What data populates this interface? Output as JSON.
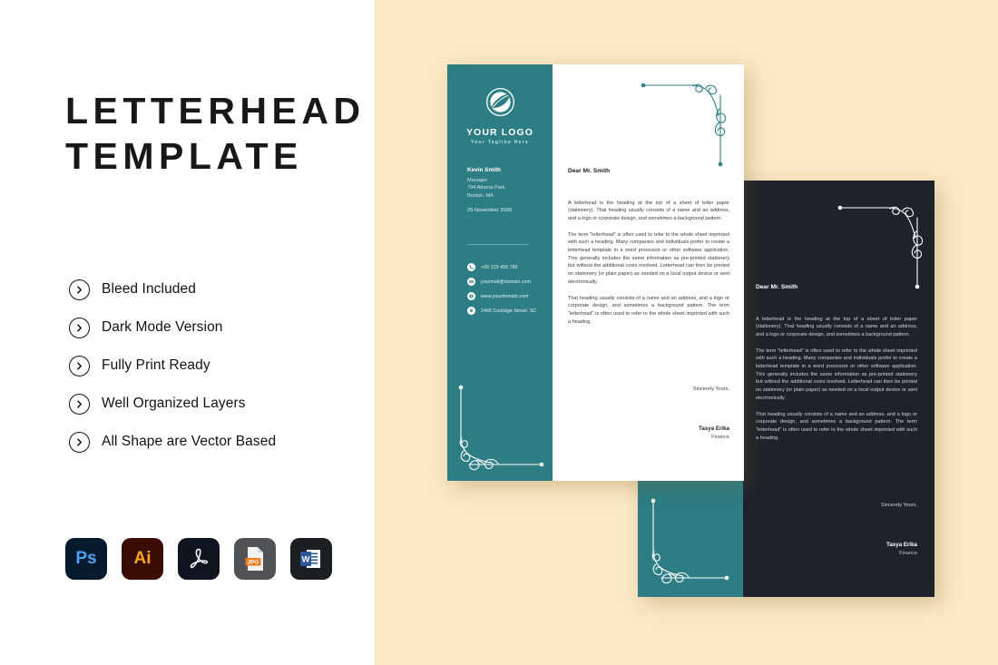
{
  "colors": {
    "left_bg": "#ffffff",
    "right_bg": "#fceac5",
    "teal": "#2d7d85",
    "dark": "#1d222c",
    "title_text": "#16181a",
    "photoshop_bg": "#071a2e",
    "photoshop_fg": "#4ea0f5",
    "illustrator_bg": "#3a0d04",
    "illustrator_fg": "#f5a623",
    "pdf_bg": "#0e1420",
    "jpg_bg": "#4f5257",
    "jpg_accent": "#f07c20",
    "word_bg": "#1b1f24",
    "word_accent": "#2b579a"
  },
  "headline": {
    "line1": "LETTERHEAD",
    "line2": "TEMPLATE"
  },
  "features": [
    {
      "label": "Bleed Included",
      "icon": "chevron-right-circle-icon"
    },
    {
      "label": "Dark Mode Version",
      "icon": "chevron-right-circle-icon"
    },
    {
      "label": "Fully Print Ready",
      "icon": "chevron-right-circle-icon"
    },
    {
      "label": "Well Organized Layers",
      "icon": "chevron-right-circle-icon"
    },
    {
      "label": "All Shape are Vector Based",
      "icon": "chevron-right-circle-icon"
    }
  ],
  "file_formats": [
    {
      "name": "photoshop-icon",
      "label": "Ps"
    },
    {
      "name": "illustrator-icon",
      "label": "Ai"
    },
    {
      "name": "pdf-icon",
      "label": ""
    },
    {
      "name": "jpg-icon",
      "label": "JPG"
    },
    {
      "name": "word-icon",
      "label": "W"
    }
  ],
  "letterhead": {
    "logo": {
      "name": "YOUR LOGO",
      "tagline": "Your Tagline Here"
    },
    "sender": {
      "name": "Kevin Smith",
      "role": "Manager",
      "address_line1": "794 Athena Park,",
      "address_line2": "Boston, MA",
      "date": "25 November 2020"
    },
    "contacts": [
      {
        "icon": "phone-icon",
        "text": "+00 123 456 789"
      },
      {
        "icon": "mail-icon",
        "text": "yourmail@domain.com"
      },
      {
        "icon": "globe-icon",
        "text": "www.yourdomain.com"
      },
      {
        "icon": "location-icon",
        "text": "2466 Coolidge Street, SC"
      }
    ],
    "greeting": "Dear Mr. Smith",
    "paragraphs": [
      "A letterhead is the heading at the top of a sheet of letter paper (stationery). That heading usually consists of a name and an address, and a logo or corporate design, and sometimes a background pattern.",
      "The term \"letterhead\" is often used to refer to the whole sheet imprinted with such a heading. Many companies and individuals prefer to create a letterhead template in a word processor or other software application. This generally includes the same information as pre-printed stationery but without the additional costs involved. Letterhead can then be printed on stationery (or plain paper) as needed on a local output device or sent electronically.",
      "That heading usually consists of a name and an address, and a logo or corporate design, and sometimes a background pattern. The term \"letterhead\" is often used to refer to the whole sheet imprinted with such a heading."
    ],
    "closing": "Sincerely Yours,",
    "signature": {
      "name": "Tasya Erika",
      "role": "Finance"
    }
  },
  "letterhead_dark": {
    "greeting": "Dear Mr. Smith",
    "paragraphs": [
      "A letterhead is the heading at the top of a sheet of letter paper (stationery). That heading usually consists of a name and an address, and a logo or corporate design, and sometimes a background pattern.",
      "The term \"letterhead\" is often used to refer to the whole sheet imprinted with such a heading. Many companies and individuals prefer to create a letterhead template in a word processor or other software application. This generally includes the same information as pre-printed stationery but without the additional costs involved. Letterhead can then be printed on stationery (or plain paper) as needed on a local output device or sent electronically.",
      "That heading usually consists of a name and an address, and a logo or corporate design, and sometimes a background pattern. The term \"letterhead\" is often used to refer to the whole sheet imprinted with such a heading."
    ],
    "closing": "Sincerely Yours,",
    "signature": {
      "name": "Tasya Erika",
      "role": "Finance"
    }
  }
}
